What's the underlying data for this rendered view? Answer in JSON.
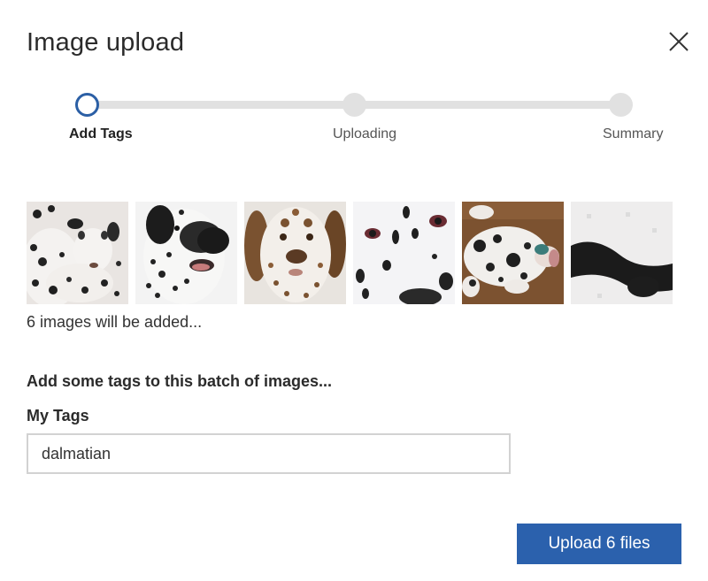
{
  "dialog": {
    "title": "Image upload",
    "close_icon": "close-icon"
  },
  "stepper": {
    "active_index": 0,
    "steps": [
      {
        "label": "Add Tags"
      },
      {
        "label": "Uploading"
      },
      {
        "label": "Summary"
      }
    ]
  },
  "images": {
    "count_text": "6 images will be added...",
    "thumbnails": [
      {
        "subject": "dalmatian puppy lying down"
      },
      {
        "subject": "dalmatian face close-up"
      },
      {
        "subject": "liver-spotted dalmatian portrait"
      },
      {
        "subject": "dalmatian eyes close-up"
      },
      {
        "subject": "dalmatian lying on back"
      },
      {
        "subject": "dalmatian spotted fur"
      }
    ]
  },
  "tags": {
    "heading": "Add some tags to this batch of images...",
    "label": "My Tags",
    "value": "dalmatian"
  },
  "actions": {
    "upload_label": "Upload 6 files"
  },
  "colors": {
    "accent": "#2b61ad",
    "step_active_ring": "#2b5fa5",
    "step_inactive": "#e1e1e1"
  }
}
